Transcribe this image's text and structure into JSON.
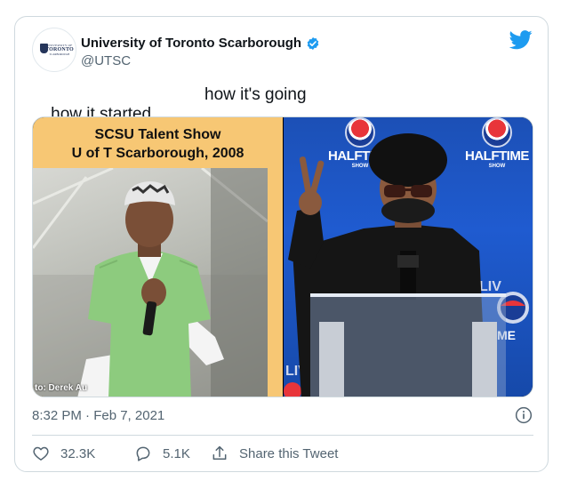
{
  "tweet": {
    "avatar": {
      "icon": "uoft-crest-icon",
      "logo_text_top": "UNIVERSITY OF",
      "logo_text_main": "TORONTO",
      "logo_text_bottom": "SCARBOROUGH"
    },
    "display_name": "University of Toronto Scarborough",
    "handle": "@UTSC",
    "verified": true,
    "text_left": "how it started",
    "text_right": "how it's going",
    "media": {
      "left_image": {
        "caption_line1": "SCSU Talent Show",
        "caption_line2": "U of T Scarborough, 2008",
        "photo_credit": "to: Derek Au",
        "background": "#f7c774"
      },
      "right_image": {
        "brand_logo_text": "HALFTIME",
        "brand_logo_sub": "SHOW",
        "brand_top": "pepsi",
        "podium_text": "LIV"
      }
    },
    "timestamp": "8:32 PM · Feb 7, 2021",
    "actions": {
      "likes": "32.3K",
      "replies": "5.1K",
      "share_label": "Share this Tweet"
    }
  },
  "colors": {
    "accent": "#1d9bf0",
    "text_primary": "#0f1419",
    "text_secondary": "#536471",
    "border": "#cfd9de"
  }
}
